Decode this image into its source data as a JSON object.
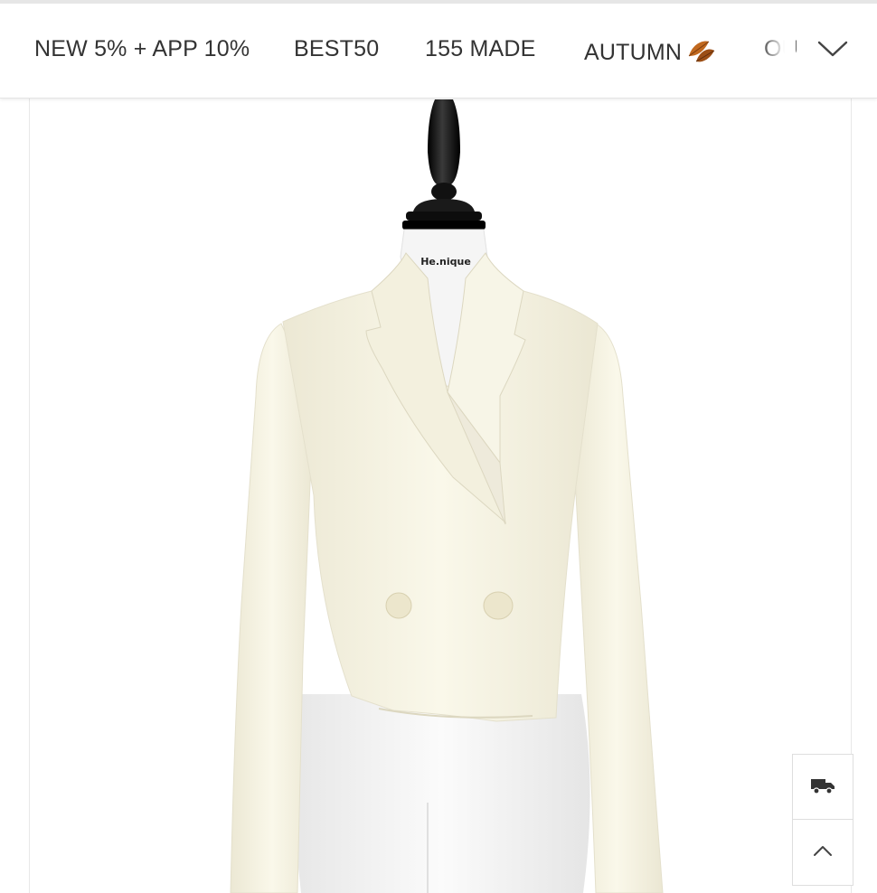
{
  "nav": {
    "items": [
      {
        "label": "NEW 5% + APP 10%"
      },
      {
        "label": "BEST50"
      },
      {
        "label": "155 MADE"
      },
      {
        "label": "AUTUMN"
      },
      {
        "label": "OU"
      }
    ],
    "more_icon": "chevron-down-icon"
  },
  "product": {
    "mannequin_brand": "He.nique",
    "image_description_icon": "product-photo"
  },
  "floating": {
    "delivery_icon": "truck-icon",
    "top_icon": "chevron-up-icon"
  },
  "colors": {
    "nav_text": "#333333",
    "jacket": "#f7f4e6",
    "leaf": "#b5651d"
  }
}
